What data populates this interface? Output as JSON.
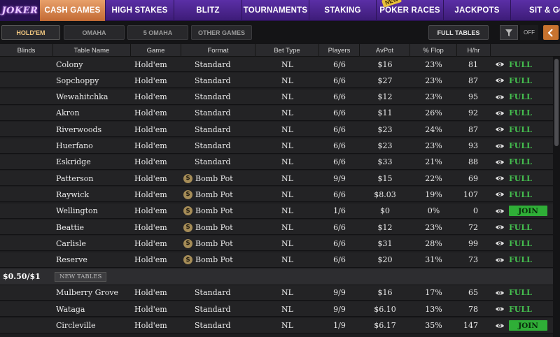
{
  "logo": {
    "text": "JOKER"
  },
  "topnav": [
    {
      "label": "CASH GAMES",
      "active": true
    },
    {
      "label": "HIGH STAKES"
    },
    {
      "label": "BLITZ"
    },
    {
      "label": "TOURNAMENTS"
    },
    {
      "label": "STAKING"
    },
    {
      "label": "POKER RACES",
      "badge": "NEW"
    },
    {
      "label": "JACKPOTS"
    },
    {
      "label": "SIT & GO"
    }
  ],
  "subnav": {
    "tabs": [
      {
        "label": "HOLD'EM",
        "active": true
      },
      {
        "label": "OMAHA"
      },
      {
        "label": "5 OMAHA"
      },
      {
        "label": "OTHER GAMES"
      }
    ],
    "full_tables_label": "FULL TABLES",
    "filter_state": "OFF"
  },
  "columns": [
    "Blinds",
    "Table Name",
    "Game",
    "Format",
    "Bet Type",
    "Players",
    "AvPot",
    "% Flop",
    "H/hr"
  ],
  "rows": [
    {
      "name": "Colony",
      "game": "Hold'em",
      "format": "Standard",
      "bomb": false,
      "bet": "NL",
      "players": "6/6",
      "avpot": "$16",
      "flop": "23%",
      "hhr": "81",
      "status": "FULL"
    },
    {
      "name": "Sopchoppy",
      "game": "Hold'em",
      "format": "Standard",
      "bomb": false,
      "bet": "NL",
      "players": "6/6",
      "avpot": "$27",
      "flop": "23%",
      "hhr": "87",
      "status": "FULL"
    },
    {
      "name": "Wewahitchka",
      "game": "Hold'em",
      "format": "Standard",
      "bomb": false,
      "bet": "NL",
      "players": "6/6",
      "avpot": "$12",
      "flop": "23%",
      "hhr": "95",
      "status": "FULL"
    },
    {
      "name": "Akron",
      "game": "Hold'em",
      "format": "Standard",
      "bomb": false,
      "bet": "NL",
      "players": "6/6",
      "avpot": "$11",
      "flop": "26%",
      "hhr": "92",
      "status": "FULL"
    },
    {
      "name": "Riverwoods",
      "game": "Hold'em",
      "format": "Standard",
      "bomb": false,
      "bet": "NL",
      "players": "6/6",
      "avpot": "$23",
      "flop": "24%",
      "hhr": "87",
      "status": "FULL"
    },
    {
      "name": "Huerfano",
      "game": "Hold'em",
      "format": "Standard",
      "bomb": false,
      "bet": "NL",
      "players": "6/6",
      "avpot": "$23",
      "flop": "23%",
      "hhr": "93",
      "status": "FULL"
    },
    {
      "name": "Eskridge",
      "game": "Hold'em",
      "format": "Standard",
      "bomb": false,
      "bet": "NL",
      "players": "6/6",
      "avpot": "$33",
      "flop": "21%",
      "hhr": "88",
      "status": "FULL"
    },
    {
      "name": "Patterson",
      "game": "Hold'em",
      "format": "Bomb Pot",
      "bomb": true,
      "bet": "NL",
      "players": "9/9",
      "avpot": "$15",
      "flop": "22%",
      "hhr": "69",
      "status": "FULL"
    },
    {
      "name": "Raywick",
      "game": "Hold'em",
      "format": "Bomb Pot",
      "bomb": true,
      "bet": "NL",
      "players": "6/6",
      "avpot": "$8.03",
      "flop": "19%",
      "hhr": "107",
      "status": "FULL"
    },
    {
      "name": "Wellington",
      "game": "Hold'em",
      "format": "Bomb Pot",
      "bomb": true,
      "bet": "NL",
      "players": "1/6",
      "avpot": "$0",
      "flop": "0%",
      "hhr": "0",
      "status": "JOIN"
    },
    {
      "name": "Beattie",
      "game": "Hold'em",
      "format": "Bomb Pot",
      "bomb": true,
      "bet": "NL",
      "players": "6/6",
      "avpot": "$12",
      "flop": "23%",
      "hhr": "72",
      "status": "FULL"
    },
    {
      "name": "Carlisle",
      "game": "Hold'em",
      "format": "Bomb Pot",
      "bomb": true,
      "bet": "NL",
      "players": "6/6",
      "avpot": "$31",
      "flop": "28%",
      "hhr": "99",
      "status": "FULL"
    },
    {
      "name": "Reserve",
      "game": "Hold'em",
      "format": "Bomb Pot",
      "bomb": true,
      "bet": "NL",
      "players": "6/6",
      "avpot": "$20",
      "flop": "31%",
      "hhr": "73",
      "status": "FULL"
    }
  ],
  "group": {
    "blinds": "$0.50/$1",
    "new_tables_label": "NEW TABLES"
  },
  "group_rows": [
    {
      "name": "Mulberry Grove",
      "game": "Hold'em",
      "format": "Standard",
      "bomb": false,
      "bet": "NL",
      "players": "9/9",
      "avpot": "$16",
      "flop": "17%",
      "hhr": "65",
      "status": "FULL"
    },
    {
      "name": "Wataga",
      "game": "Hold'em",
      "format": "Standard",
      "bomb": false,
      "bet": "NL",
      "players": "9/9",
      "avpot": "$6.10",
      "flop": "13%",
      "hhr": "78",
      "status": "FULL"
    },
    {
      "name": "Circleville",
      "game": "Hold'em",
      "format": "Standard",
      "bomb": false,
      "bet": "NL",
      "players": "1/9",
      "avpot": "$6.17",
      "flop": "35%",
      "hhr": "147",
      "status": "JOIN"
    }
  ],
  "colors": {
    "accent": "#c8732f",
    "nav": "#4a2590",
    "full": "#45c04f",
    "join": "#2fae37"
  }
}
